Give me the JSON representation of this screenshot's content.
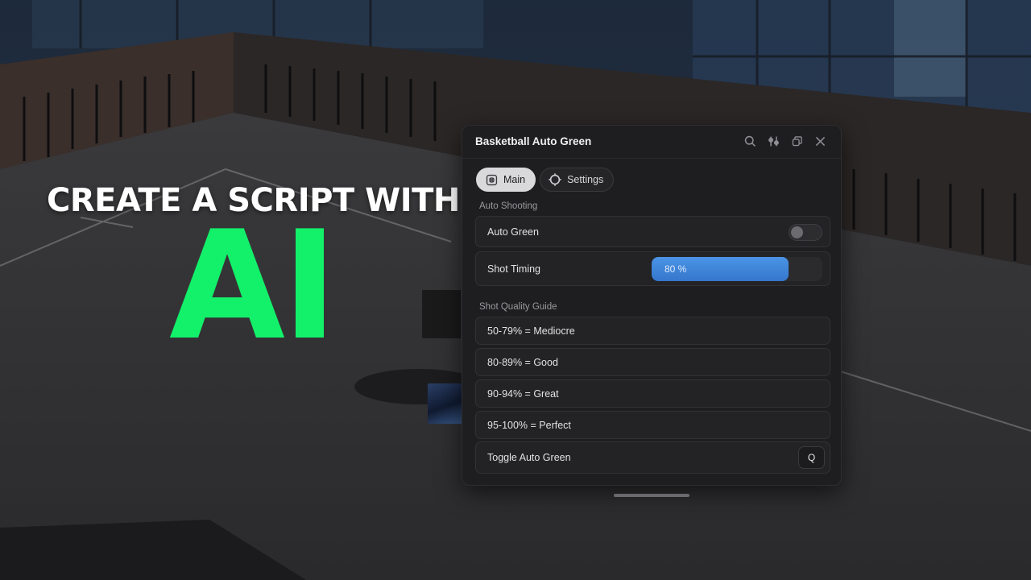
{
  "overlay": {
    "headline": "CREATE A SCRIPT WITH",
    "big_text": "AI"
  },
  "window": {
    "title": "Basketball Auto Green",
    "title_icons": [
      "search-icon",
      "sliders-icon",
      "restore-icon",
      "close-icon"
    ],
    "tabs": [
      {
        "label": "Main",
        "icon": "main-icon",
        "active": true
      },
      {
        "label": "Settings",
        "icon": "settings-icon",
        "active": false
      }
    ],
    "sections": {
      "auto_shooting": "Auto Shooting",
      "quality_guide": "Shot Quality Guide"
    },
    "auto_green": {
      "label": "Auto Green",
      "enabled": false
    },
    "shot_timing": {
      "label": "Shot Timing",
      "value_text": "80 %",
      "value": 80
    },
    "guide": [
      "50-79% = Mediocre",
      "80-89% = Good",
      "90-94% = Great",
      "95-100% = Perfect"
    ],
    "toggle_keybind": {
      "label": "Toggle Auto Green",
      "key": "Q"
    }
  },
  "colors": {
    "accent_blue": "#3d86da",
    "ai_green": "#13f06a",
    "window_bg": "#1e1e20"
  }
}
